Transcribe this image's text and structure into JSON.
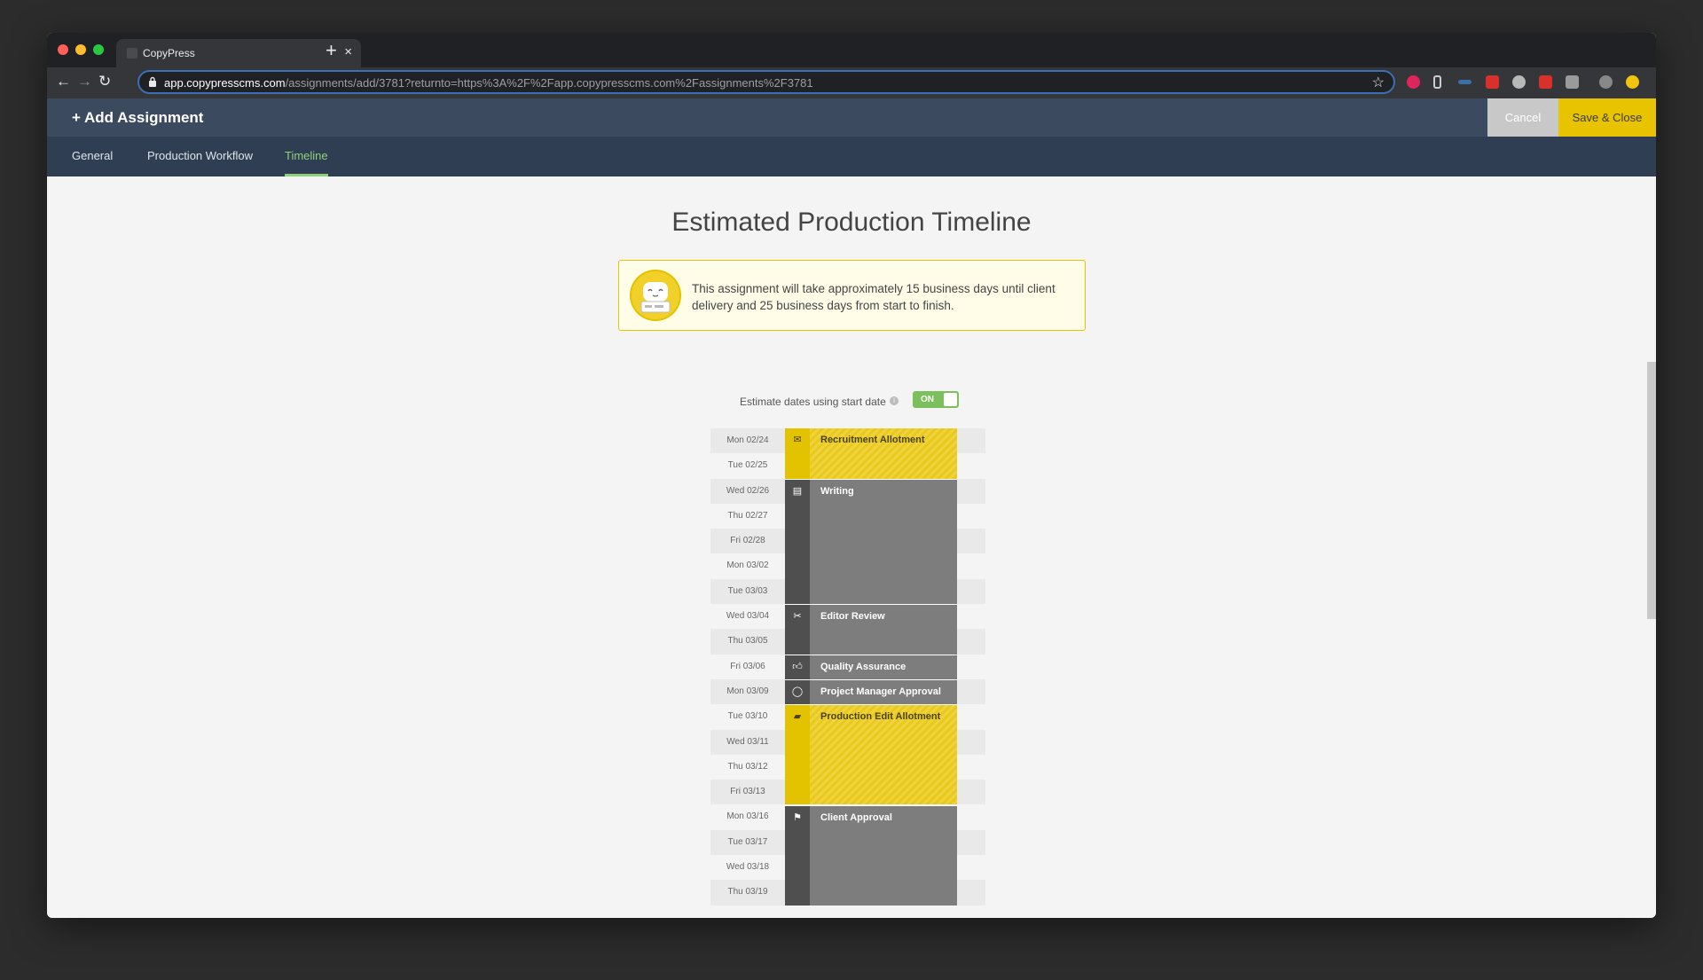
{
  "browser": {
    "tab_title": "CopyPress",
    "url_host": "app.copypresscms.com",
    "url_path": "/assignments/add/3781?returnto=https%3A%2F%2Fapp.copypresscms.com%2Fassignments%2F3781"
  },
  "header": {
    "title": "+ Add Assignment",
    "cancel_label": "Cancel",
    "save_label": "Save & Close"
  },
  "tabs": [
    {
      "label": "General",
      "active": false
    },
    {
      "label": "Production Workflow",
      "active": false
    },
    {
      "label": "Timeline",
      "active": true
    }
  ],
  "hero": {
    "title": "Estimated Production Timeline",
    "notice": "This assignment will take approximately 15 business days until client delivery and 25 business days from start to finish."
  },
  "toggle": {
    "label": "Estimate dates using start date",
    "state": "ON"
  },
  "dates": [
    "Mon 02/24",
    "Tue 02/25",
    "Wed 02/26",
    "Thu 02/27",
    "Fri 02/28",
    "Mon 03/02",
    "Tue 03/03",
    "Wed 03/04",
    "Thu 03/05",
    "Fri 03/06",
    "Mon 03/09",
    "Tue 03/10",
    "Wed 03/11",
    "Thu 03/12",
    "Fri 03/13",
    "Mon 03/16",
    "Tue 03/17",
    "Wed 03/18",
    "Thu 03/19"
  ],
  "phases": [
    {
      "name": "Recruitment Allotment",
      "icon": "envelope-icon",
      "color": "yellow",
      "start": 0,
      "days": 2
    },
    {
      "name": "Writing",
      "icon": "newspaper-icon",
      "color": "grey",
      "start": 2,
      "days": 5
    },
    {
      "name": "Editor Review",
      "icon": "scissors-icon",
      "color": "grey",
      "start": 7,
      "days": 2
    },
    {
      "name": "Quality Assurance",
      "icon": "thumbs-up-icon",
      "color": "grey",
      "start": 9,
      "days": 1
    },
    {
      "name": "Project Manager Approval",
      "icon": "speech-bubble-icon",
      "color": "grey",
      "start": 10,
      "days": 1
    },
    {
      "name": "Production Edit Allotment",
      "icon": "eraser-icon",
      "color": "yellow",
      "start": 11,
      "days": 4
    },
    {
      "name": "Client Approval",
      "icon": "flag-icon",
      "color": "grey",
      "start": 15,
      "days": 4
    }
  ],
  "colors": {
    "accent_yellow": "#e8c300",
    "header_blue": "#3b4a5e",
    "tab_active_green": "#8fd17a"
  }
}
